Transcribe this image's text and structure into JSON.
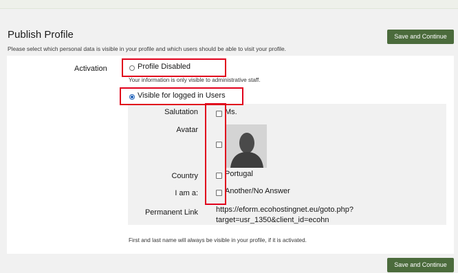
{
  "header": {
    "title": "Publish Profile",
    "subtitle": "Please select which personal data is visible in your profile and which users should be able to visit your profile.",
    "save_label": "Save and Continue"
  },
  "activation": {
    "label": "Activation",
    "options": [
      {
        "label": "Profile Disabled",
        "note": "Your information is only visible to administrative staff.",
        "selected": false
      },
      {
        "label": "Visible for logged in Users",
        "selected": true
      }
    ]
  },
  "fields": {
    "salutation": {
      "label": "Salutation",
      "value": "Ms.",
      "checked": false
    },
    "avatar": {
      "label": "Avatar",
      "checked": false
    },
    "country": {
      "label": "Country",
      "value": "Portugal",
      "checked": false
    },
    "i_am_a": {
      "label": "I am a:",
      "value": "Another/No Answer",
      "checked": false
    },
    "permanent_link": {
      "label": "Permanent Link",
      "value": "https://eform.ecohostingnet.eu/goto.php?target=usr_1350&client_id=ecohn"
    }
  },
  "footer": {
    "note": "First and last name will always be visible in your profile, if it is activated.",
    "save_label": "Save and Continue"
  },
  "colors": {
    "button": "#4b6b3c",
    "highlight": "#e0001b",
    "radio_selected": "#1d5fb8"
  }
}
